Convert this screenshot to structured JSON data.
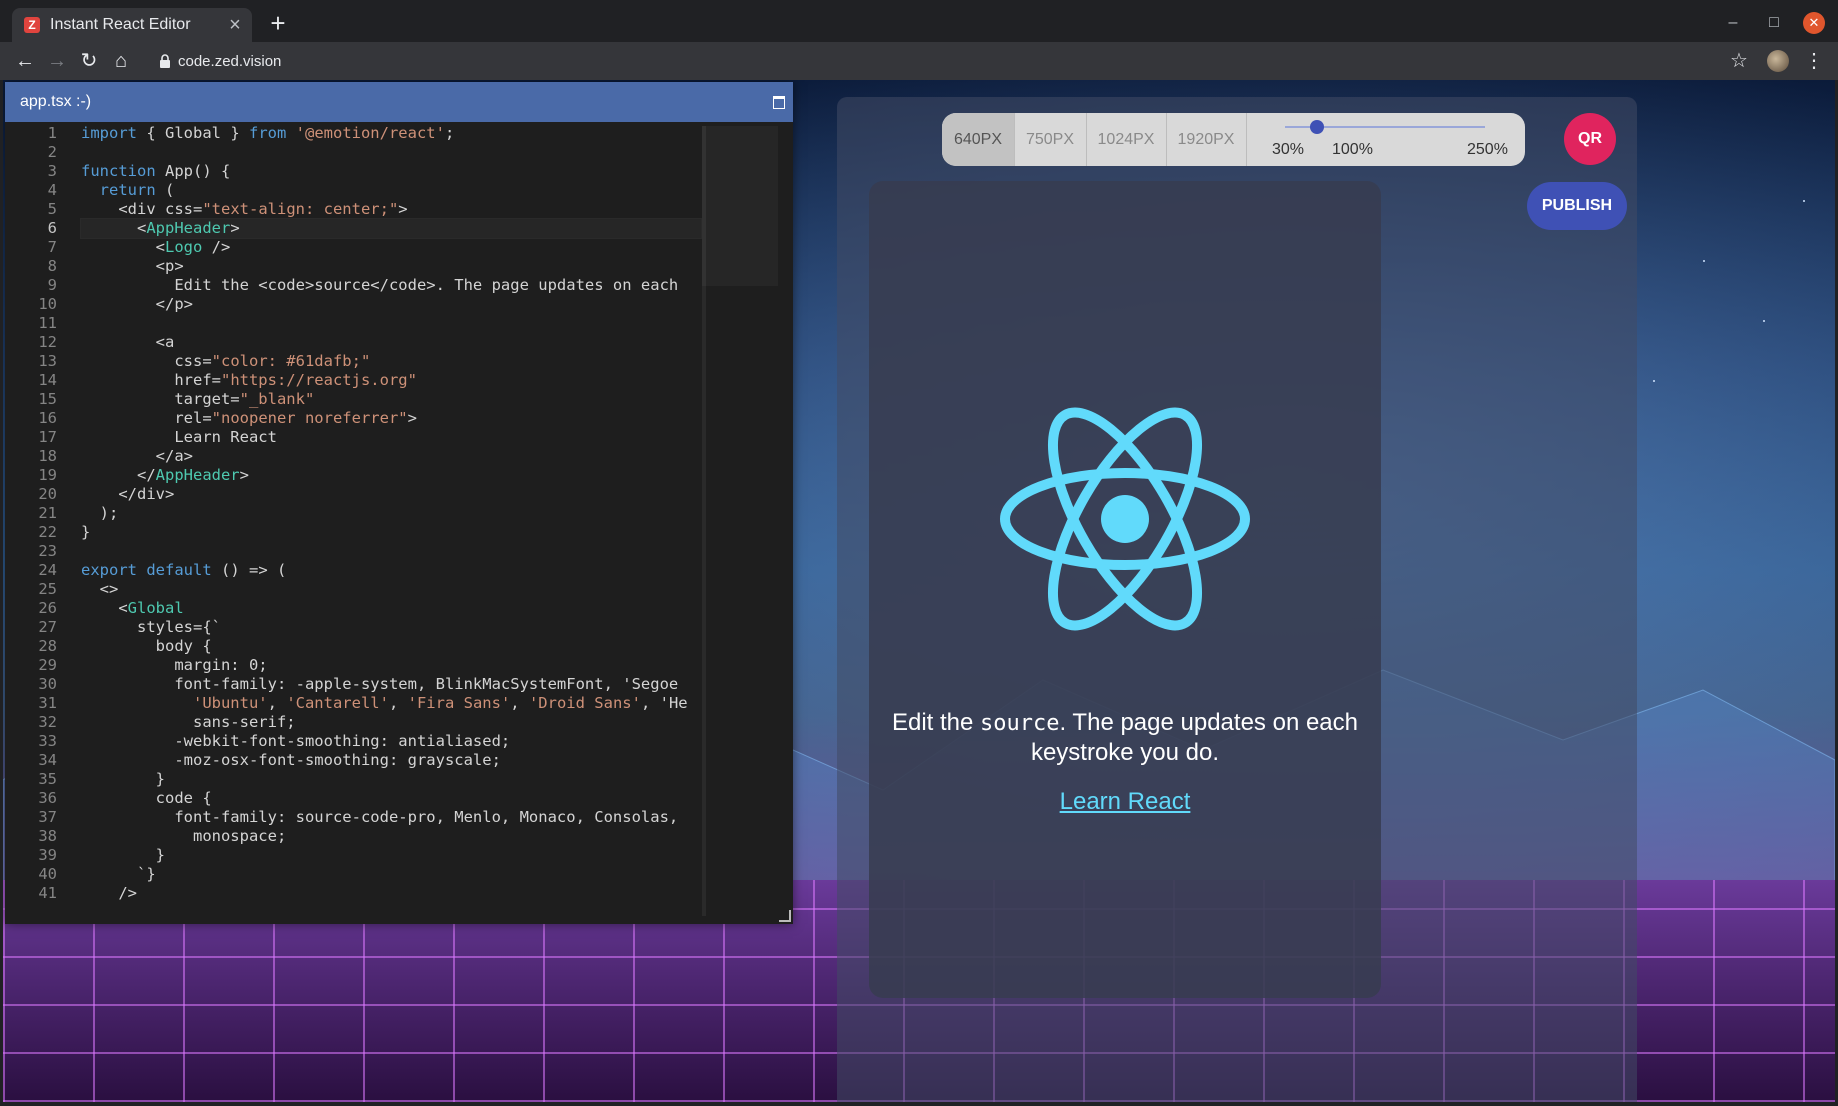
{
  "browser": {
    "tab_title": "Instant React Editor",
    "tab_favicon": "Z",
    "url": "code.zed.vision"
  },
  "editor": {
    "filename": "app.tsx :-)",
    "current_line": 6,
    "lines": [
      "import { Global } from '@emotion/react';",
      "",
      "function App() {",
      "  return (",
      "    <div css=\"text-align: center;\">",
      "      <AppHeader>",
      "        <Logo />",
      "        <p>",
      "          Edit the <code>source</code>. The page updates on each",
      "        </p>",
      "",
      "        <a",
      "          css=\"color: #61dafb;\"",
      "          href=\"https://reactjs.org\"",
      "          target=\"_blank\"",
      "          rel=\"noopener noreferrer\">",
      "          Learn React",
      "        </a>",
      "      </AppHeader>",
      "    </div>",
      "  );",
      "}",
      "",
      "export default () => (",
      "  <>",
      "    <Global",
      "      styles={`",
      "        body {",
      "          margin: 0;",
      "          font-family: -apple-system, BlinkMacSystemFont, 'Segoe",
      "            'Ubuntu', 'Cantarell', 'Fira Sans', 'Droid Sans', 'He",
      "            sans-serif;",
      "          -webkit-font-smoothing: antialiased;",
      "          -moz-osx-font-smoothing: grayscale;",
      "        }",
      "        code {",
      "          font-family: source-code-pro, Menlo, Monaco, Consolas,",
      "            monospace;",
      "        }",
      "      `}",
      "    />"
    ]
  },
  "preview": {
    "sizes": [
      "640PX",
      "750PX",
      "1024PX",
      "1920PX"
    ],
    "active_size": "640PX",
    "zoom_labels": [
      "30%",
      "100%",
      "250%"
    ],
    "zoom_value_fraction": 0.16,
    "qr_label": "QR",
    "publish_label": "PUBLISH",
    "app_text_before": "Edit the ",
    "app_text_code": "source",
    "app_text_after": ". The page updates on each keystroke you do.",
    "app_link": "Learn React",
    "accent_colors": {
      "react": "#61dafb",
      "publish": "#3f51b5",
      "qr": "#e0245e",
      "editor_header": "#4a6aa8"
    }
  }
}
